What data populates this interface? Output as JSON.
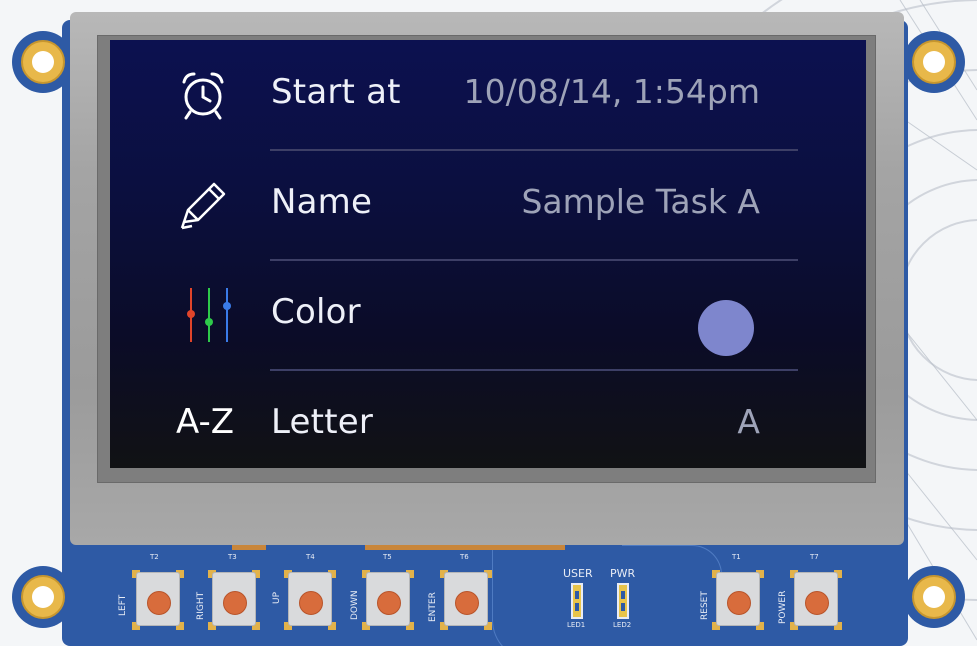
{
  "screen": {
    "rows": [
      {
        "label": "Start at",
        "value": "10/08/14, 1:54pm",
        "icon": "alarm-clock-icon"
      },
      {
        "label": "Name",
        "value": "Sample Task A",
        "icon": "pencil-icon"
      },
      {
        "label": "Color",
        "value_color": "#7e86cd",
        "icon": "sliders-icon"
      },
      {
        "label": "Letter",
        "value": "A",
        "icon_text": "A-Z"
      }
    ],
    "colors": {
      "label": "#eef0f8",
      "value": "#9ea3b8",
      "divider": "#3d3f66",
      "slider_red": "#e0442a",
      "slider_green": "#2ec94a",
      "slider_blue": "#3a7be8"
    }
  },
  "board": {
    "buttons": [
      {
        "label": "LEFT",
        "ref": "T2"
      },
      {
        "label": "RIGHT",
        "ref": "T3"
      },
      {
        "label": "UP",
        "ref": "T4"
      },
      {
        "label": "DOWN",
        "ref": "T5"
      },
      {
        "label": "ENTER",
        "ref": "T6"
      },
      {
        "label": "RESET",
        "ref": "T1"
      },
      {
        "label": "POWER",
        "ref": "T7"
      }
    ],
    "leds": [
      {
        "label": "USER",
        "ref": "LED1"
      },
      {
        "label": "PWR",
        "ref": "LED2"
      }
    ],
    "colors": {
      "pcb": "#2e5aa5",
      "button_cap": "#d86c3c",
      "pad_gold": "#e8b84a"
    }
  }
}
